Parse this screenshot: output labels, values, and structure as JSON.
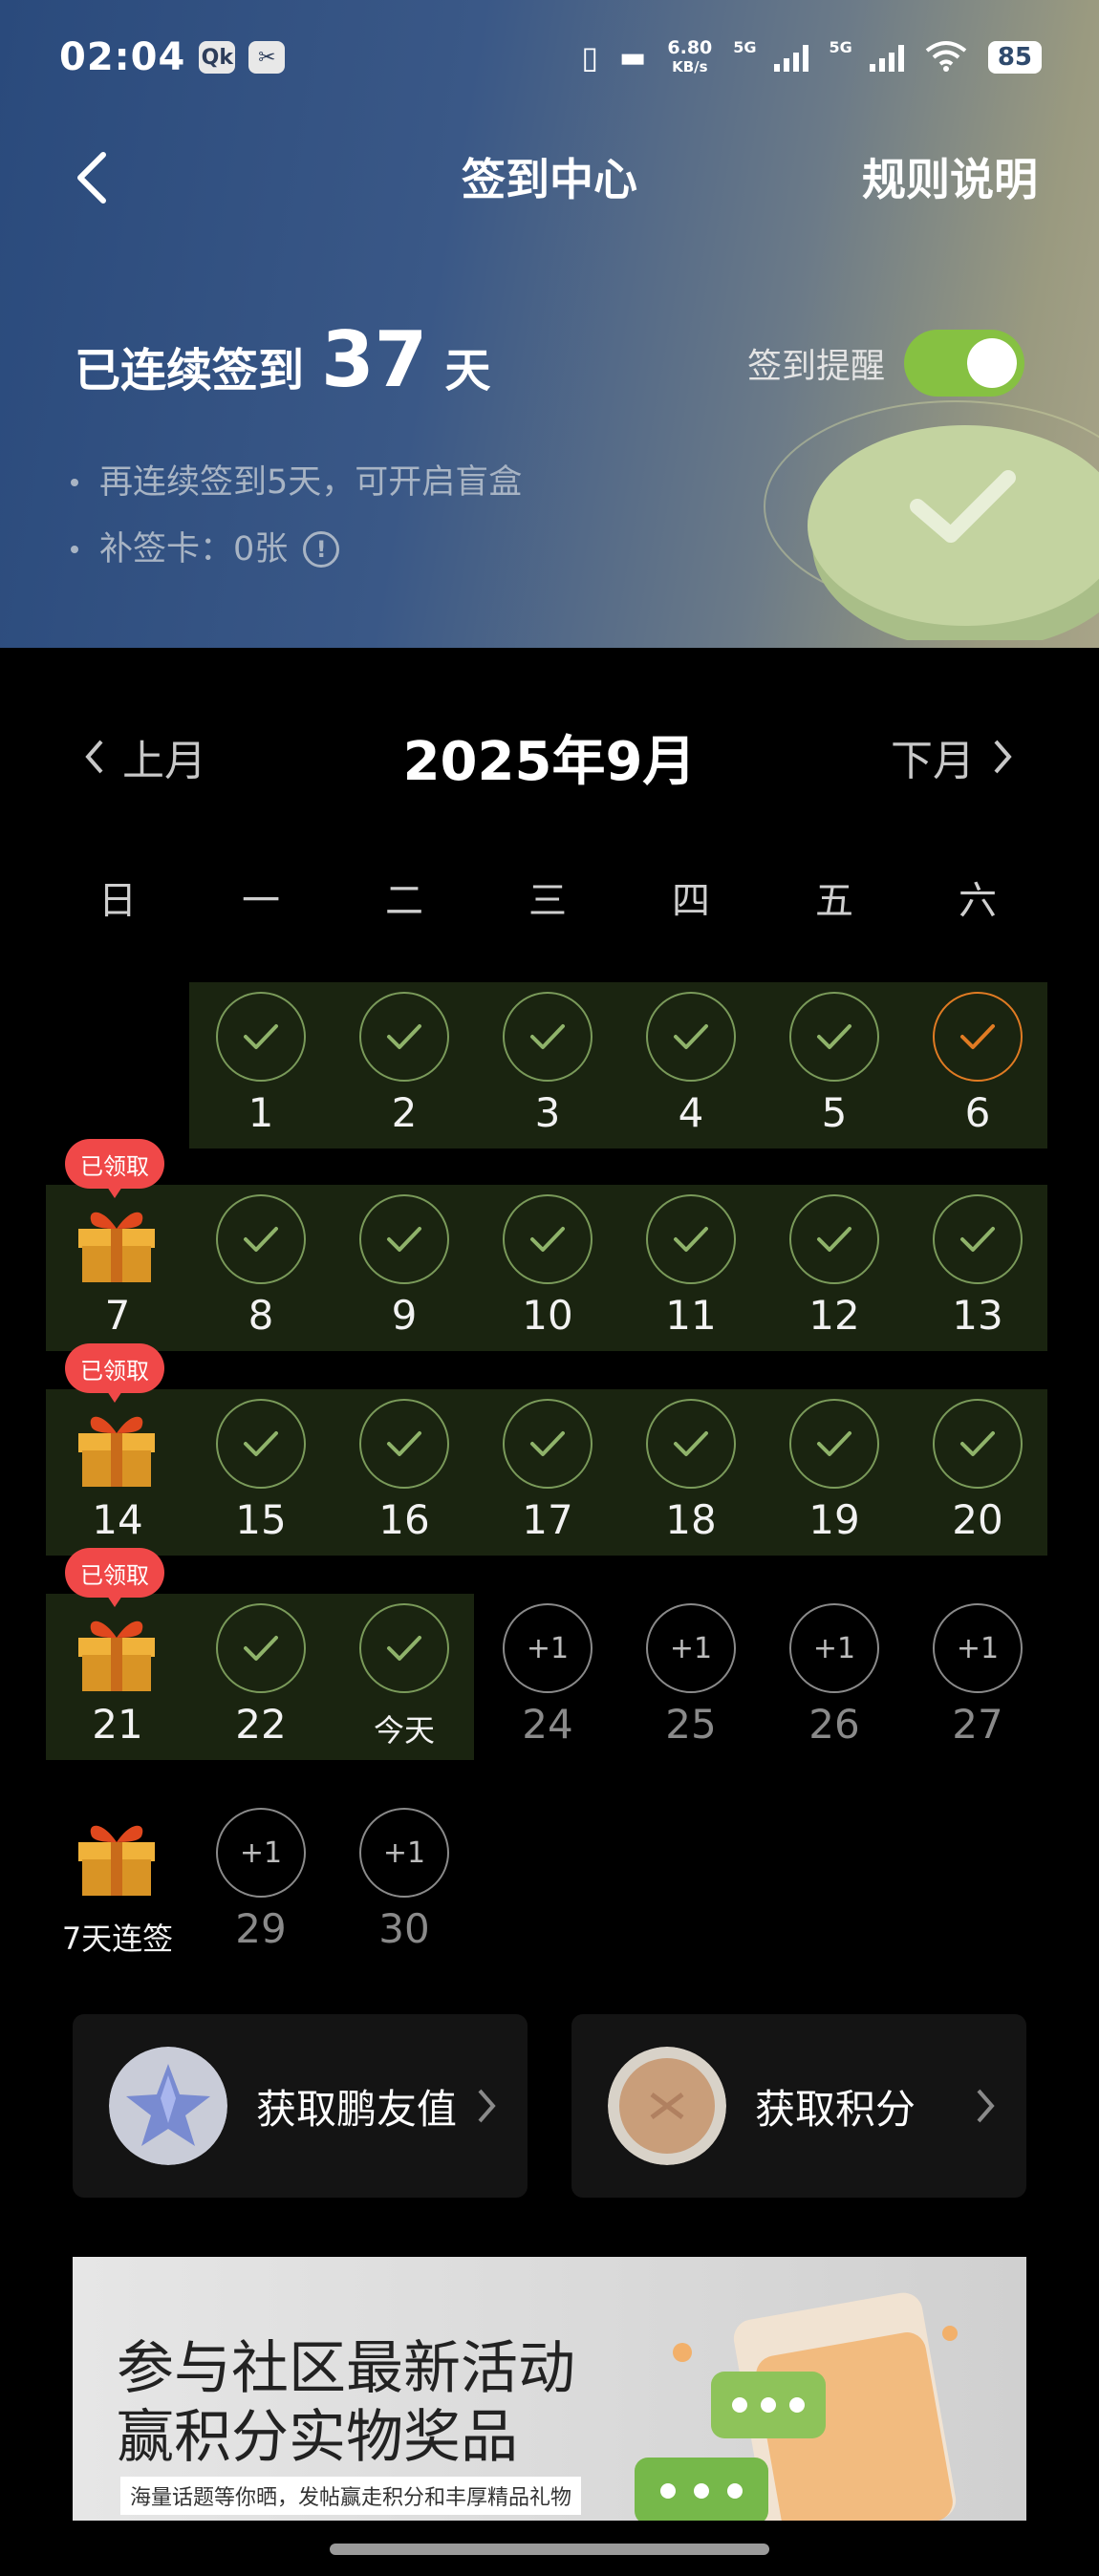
{
  "status": {
    "time": "02:04",
    "speed": "6.80",
    "speed_unit": "KB/s",
    "net1": "5G",
    "net2": "5G",
    "battery": "85",
    "icon1": "Qk"
  },
  "nav": {
    "title": "签到中心",
    "rules": "规则说明"
  },
  "streak": {
    "prefix": "已连续签到",
    "days": "37",
    "suffix": "天"
  },
  "reminder": {
    "label": "签到提醒",
    "on": true
  },
  "bullets": {
    "line1": "再连续签到5天，可开启盲盒",
    "line2": "补签卡：0张"
  },
  "calendar": {
    "prev": "上月",
    "current": "2025年9月",
    "next": "下月",
    "weekdays": [
      "日",
      "一",
      "二",
      "三",
      "四",
      "五",
      "六"
    ],
    "claimed_label": "已领取",
    "future_label": "+1",
    "today_label": "今天",
    "gift_label": "7天连签",
    "days": {
      "d1": "1",
      "d2": "2",
      "d3": "3",
      "d4": "4",
      "d5": "5",
      "d6": "6",
      "d7": "7",
      "d8": "8",
      "d9": "9",
      "d10": "10",
      "d11": "11",
      "d12": "12",
      "d13": "13",
      "d14": "14",
      "d15": "15",
      "d16": "16",
      "d17": "17",
      "d18": "18",
      "d19": "19",
      "d20": "20",
      "d21": "21",
      "d22": "22",
      "d24": "24",
      "d25": "25",
      "d26": "26",
      "d27": "27",
      "d29": "29",
      "d30": "30"
    }
  },
  "cards": {
    "friend": "获取鹏友值",
    "points": "获取积分"
  },
  "banner": {
    "line1": "参与社区最新活动",
    "line2": "赢积分实物奖品",
    "line3": "海量话题等你晒，发帖赢走积分和丰厚精品礼物"
  },
  "colors": {
    "accent_green": "#86c142",
    "check_green": "#7a9a5a",
    "orange": "#e07b23",
    "claimed_red": "#f04848"
  }
}
